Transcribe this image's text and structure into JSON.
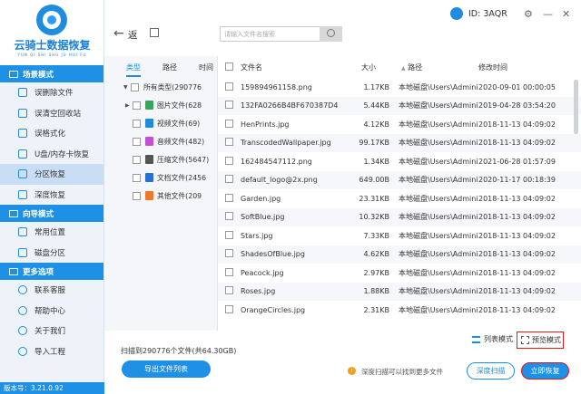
{
  "app": {
    "logo_title": "云骑士数据恢复",
    "logo_subtitle": "YUN QI SHI SHU JU HUI FU",
    "version": "版本号：3.21.0.92",
    "user_id": "ID: 3AQR",
    "accent_color": "#1e90e6"
  },
  "window_controls": {
    "settings": "⚙",
    "minimize": "—",
    "close": "✕"
  },
  "toolbar": {
    "back_icon": "←",
    "back_label": "返",
    "search_placeholder": "请输入文件名搜索"
  },
  "sidebar": {
    "sections": [
      {
        "title": "场景模式",
        "items": [
          {
            "label": "误删除文件",
            "icon": "trash-icon"
          },
          {
            "label": "误清空回收站",
            "icon": "recycle-icon"
          },
          {
            "label": "误格式化",
            "icon": "format-icon"
          },
          {
            "label": "U盘/内存卡恢复",
            "icon": "usb-icon"
          },
          {
            "label": "分区恢复",
            "icon": "partition-icon",
            "active": true
          },
          {
            "label": "深度恢复",
            "icon": "deep-icon"
          }
        ]
      },
      {
        "title": "向导模式",
        "items": [
          {
            "label": "常用位置",
            "icon": "location-icon"
          },
          {
            "label": "磁盘分区",
            "icon": "disk-icon"
          }
        ]
      },
      {
        "title": "更多选项",
        "items": [
          {
            "label": "联系客服",
            "icon": "support-icon"
          },
          {
            "label": "帮助中心",
            "icon": "help-icon"
          },
          {
            "label": "关于我们",
            "icon": "info-icon"
          },
          {
            "label": "导入工程",
            "icon": "import-icon"
          }
        ]
      }
    ]
  },
  "tree": {
    "tabs": [
      "类型",
      "路径",
      "时间"
    ],
    "root": "所有类型(290776",
    "children": [
      {
        "label": "图片文件(628",
        "color": "#3aa55a"
      },
      {
        "label": "视频文件(69)",
        "color": "#1e8de0"
      },
      {
        "label": "音频文件(482)",
        "color": "#c450d0"
      },
      {
        "label": "压缩文件(5647)",
        "color": "#555555"
      },
      {
        "label": "文档文件(2456",
        "color": "#2a6fd6"
      },
      {
        "label": "其他文件(209",
        "color": "#f07a2a"
      }
    ]
  },
  "file_table": {
    "headers": {
      "name": "文件名",
      "size": "大小",
      "path": "路径",
      "date": "修改时间"
    },
    "rows": [
      {
        "name": "159894961158.png",
        "size": "1.17KB",
        "path": "本地磁盘\\Users\\Administrat",
        "date": "2020-09-01 00:00:05"
      },
      {
        "name": "132FA0266B4BF670387D4",
        "size": "5.44KB",
        "path": "本地磁盘\\Users\\Administrat",
        "date": "2019-04-28 03:54:20"
      },
      {
        "name": "HenPrints.jpg",
        "size": "4.12KB",
        "path": "本地磁盘\\Users\\Administrat",
        "date": "2018-11-13 04:09:02"
      },
      {
        "name": "TranscodedWallpaper.jpg",
        "size": "99.17KB",
        "path": "本地磁盘\\Users\\Administrat",
        "date": "2018-11-13 04:09:02"
      },
      {
        "name": "162484547112.png",
        "size": "1.34KB",
        "path": "本地磁盘\\Users\\Administrat",
        "date": "2021-06-28 01:57:09"
      },
      {
        "name": "default_logo@2x.png",
        "size": "649.00B",
        "path": "本地磁盘\\Users\\Administrat",
        "date": "2020-11-17 00:18:39"
      },
      {
        "name": "Garden.jpg",
        "size": "23.31KB",
        "path": "本地磁盘\\Users\\Administrat",
        "date": "2018-11-13 04:09:02"
      },
      {
        "name": "SoftBlue.jpg",
        "size": "10.32KB",
        "path": "本地磁盘\\Users\\Administrat",
        "date": "2018-11-13 04:09:02"
      },
      {
        "name": "Stars.jpg",
        "size": "7.33KB",
        "path": "本地磁盘\\Users\\Administrat",
        "date": "2018-11-13 04:09:02"
      },
      {
        "name": "ShadesOfBlue.jpg",
        "size": "4.62KB",
        "path": "本地磁盘\\Users\\Administrat",
        "date": "2018-11-13 04:09:02"
      },
      {
        "name": "Peacock.jpg",
        "size": "2.97KB",
        "path": "本地磁盘\\Users\\Administrat",
        "date": "2018-11-13 04:09:02"
      },
      {
        "name": "Roses.jpg",
        "size": "1.88KB",
        "path": "本地磁盘\\Users\\Administrat",
        "date": "2018-11-13 04:09:02"
      },
      {
        "name": "OrangeCircles.jpg",
        "size": "2.31KB",
        "path": "本地磁盘\\Users\\Administrat",
        "date": "2018-11-13 04:09:02"
      }
    ]
  },
  "view_modes": {
    "list": "列表模式",
    "preview": "预览模式"
  },
  "footer": {
    "summary": "扫描到290776个文件(共64.30GB)",
    "export_label": "导出文件列表",
    "hint": "深度扫描可以找到更多文件",
    "deep_scan_label": "深度扫描",
    "recover_label": "立即恢复"
  }
}
